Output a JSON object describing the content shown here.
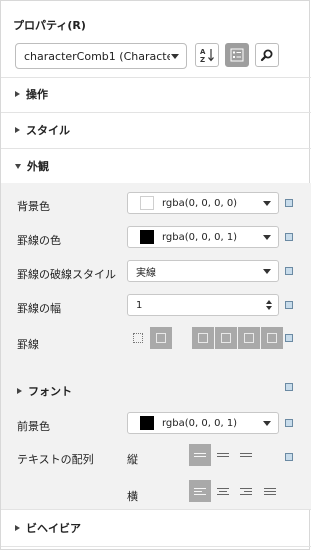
{
  "panel": {
    "title": "プロパティ(R)",
    "component_select": {
      "value": "characterComb1 (Character C..."
    },
    "toolbar": {
      "sort_icon": "sort-az-icon",
      "category_icon": "categorized-icon",
      "search_icon": "search-icon"
    }
  },
  "sections": {
    "operation": {
      "label": "操作"
    },
    "style": {
      "label": "スタイル"
    },
    "appearance": {
      "label": "外観"
    },
    "behavior": {
      "label": "ビヘイビア"
    }
  },
  "appearance": {
    "background_color": {
      "label": "背景色",
      "value": "rgba(0, 0, 0, 0)",
      "swatch": "#ffffff"
    },
    "border_color": {
      "label": "罫線の色",
      "value": "rgba(0, 0, 0, 1)",
      "swatch": "#000000"
    },
    "border_style": {
      "label": "罫線の破線スタイル",
      "value": "実線"
    },
    "border_width": {
      "label": "罫線の幅",
      "value": "1"
    },
    "border": {
      "label": "罫線"
    },
    "font": {
      "label": "フォント"
    },
    "foreground_color": {
      "label": "前景色",
      "value": "rgba(0, 0, 0, 1)",
      "swatch": "#000000"
    },
    "text_alignment": {
      "label": "テキストの配列",
      "vertical_label": "縦",
      "horizontal_label": "横"
    }
  },
  "colors": {
    "accent_square": "#c8dceb",
    "selected_button": "#a9a9a9"
  }
}
